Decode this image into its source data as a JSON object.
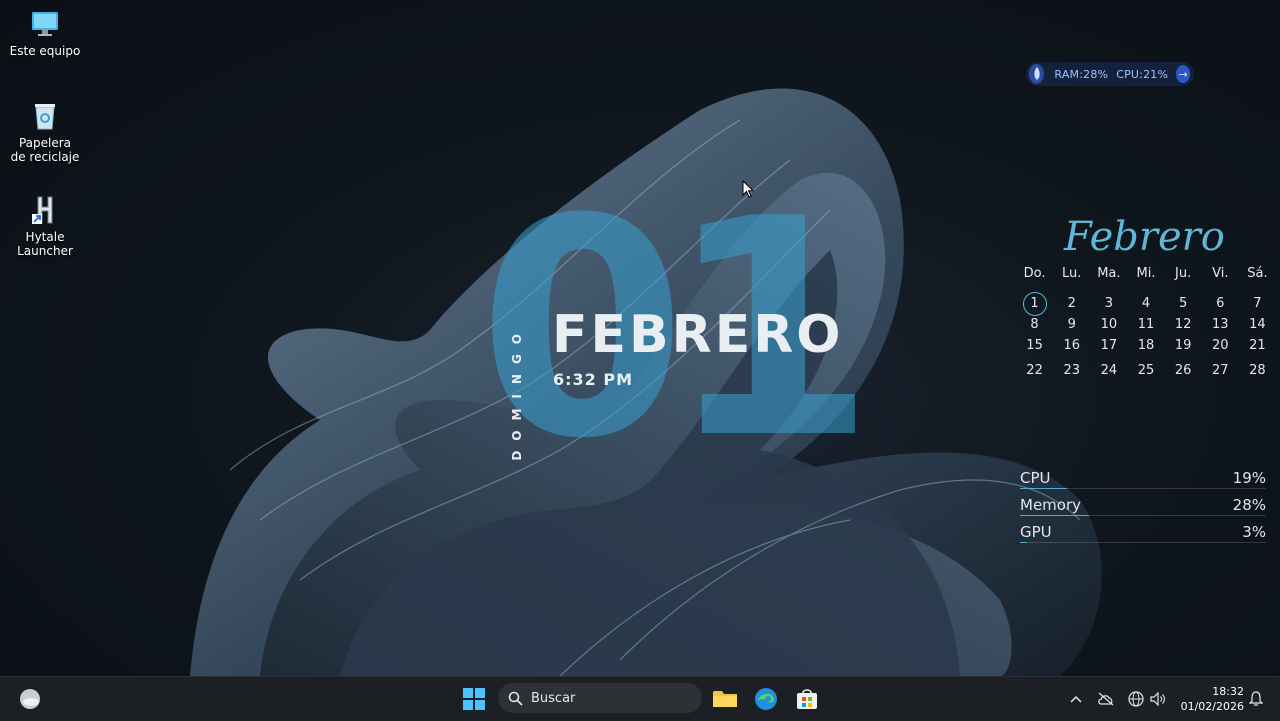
{
  "desktop": {
    "icons": [
      {
        "label": "Este equipo"
      },
      {
        "label": "Papelera de reciclaje"
      },
      {
        "label": "Hytale Launcher"
      }
    ]
  },
  "system_monitor": {
    "ram_label": "RAM:28%",
    "cpu_label": "CPU:21%"
  },
  "clock_widget": {
    "day_number": "01",
    "month": "FEBRERO",
    "time": "6:32 PM",
    "weekday": "DOMINGO"
  },
  "calendar": {
    "title": "Febrero",
    "weekdays": [
      "Do.",
      "Lu.",
      "Ma.",
      "Mi.",
      "Ju.",
      "Vi.",
      "Sá."
    ],
    "weeks": [
      [
        "1",
        "2",
        "3",
        "4",
        "5",
        "6",
        "7"
      ],
      [
        "8",
        "9",
        "10",
        "11",
        "12",
        "13",
        "14"
      ],
      [
        "15",
        "16",
        "17",
        "18",
        "19",
        "20",
        "21"
      ],
      [
        "22",
        "23",
        "24",
        "25",
        "26",
        "27",
        "28"
      ]
    ],
    "today": "1"
  },
  "stats": [
    {
      "name": "CPU",
      "value": "19%",
      "fraction": 0.19
    },
    {
      "name": "Memory",
      "value": "28%",
      "fraction": 0.28
    },
    {
      "name": "GPU",
      "value": "3%",
      "fraction": 0.03
    }
  ],
  "taskbar": {
    "search_placeholder": "Buscar",
    "time": "18:32",
    "date": "01/02/2026"
  },
  "colors": {
    "accent": "#5fb6d6",
    "taskbar": "#1c1f23"
  }
}
